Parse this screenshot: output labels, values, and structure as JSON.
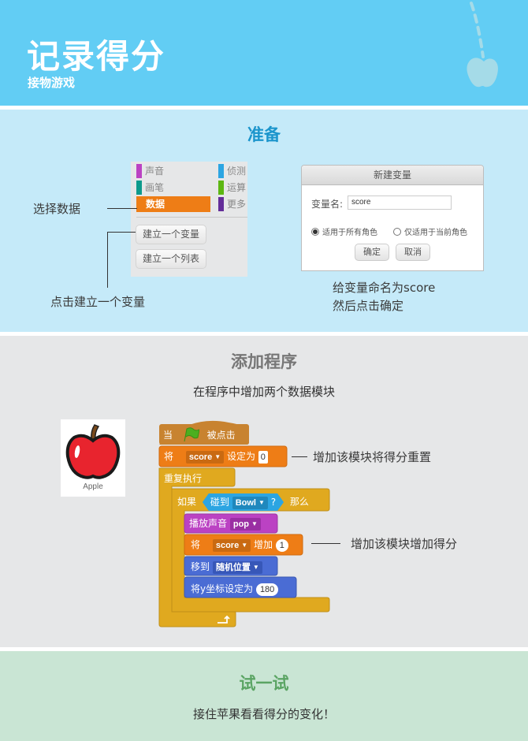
{
  "header": {
    "title": "记录得分",
    "subtitle": "接物游戏",
    "decoration_icon": "falling-apple-icon"
  },
  "colors": {
    "header_bg": "#62cdf4",
    "section_prepare_bg": "#c5eaf9",
    "section_program_bg": "#e6e7e8",
    "section_try_bg": "#c9e5d4",
    "data_category": "#ee7d16",
    "control_block": "#e0a91f",
    "event_block": "#c88330",
    "sensing_block": "#2ca5e2",
    "sound_block": "#bb42c3",
    "motion_block": "#4a6cd4"
  },
  "prepare": {
    "title": "准备",
    "palette": {
      "categories_left": [
        "声音",
        "画笔",
        "数据"
      ],
      "categories_right": [
        "侦测",
        "运算",
        "更多"
      ],
      "selected": "数据",
      "buttons": [
        "建立一个变量",
        "建立一个列表"
      ]
    },
    "callout_select_data": "选择数据",
    "callout_make_variable": "点击建立一个变量",
    "dialog": {
      "title": "新建变量",
      "name_label": "变量名:",
      "name_value": "score",
      "option_all_sprites": "适用于所有角色",
      "option_this_sprite": "仅适用于当前角色",
      "selected_option": "适用于所有角色",
      "ok_label": "确定",
      "cancel_label": "取消"
    },
    "dialog_caption_line1": "给变量命名为score",
    "dialog_caption_line2": "然后点击确定"
  },
  "program": {
    "title": "添加程序",
    "subtitle": "在程序中增加两个数据模块",
    "sprite_name": "Apple",
    "blocks": {
      "when_flag_prefix": "当",
      "when_flag_suffix": "被点击",
      "set_prefix": "将",
      "set_var": "score",
      "set_mid": "设定为",
      "set_value": "0",
      "forever": "重复执行",
      "if_label": "如果",
      "touching_label": "碰到",
      "touching_target": "Bowl",
      "touching_q": "?",
      "then_label": "那么",
      "play_sound": "播放声音",
      "sound_name": "pop",
      "change_prefix": "将",
      "change_var": "score",
      "change_mid": "增加",
      "change_value": "1",
      "goto_label": "移到",
      "goto_target": "随机位置",
      "set_y_label": "将y坐标设定为",
      "set_y_value": "180"
    },
    "note_reset": "增加该模块将得分重置",
    "note_increase": "增加该模块增加得分"
  },
  "try": {
    "title": "试一试",
    "text": "接住苹果看看得分的变化！"
  }
}
